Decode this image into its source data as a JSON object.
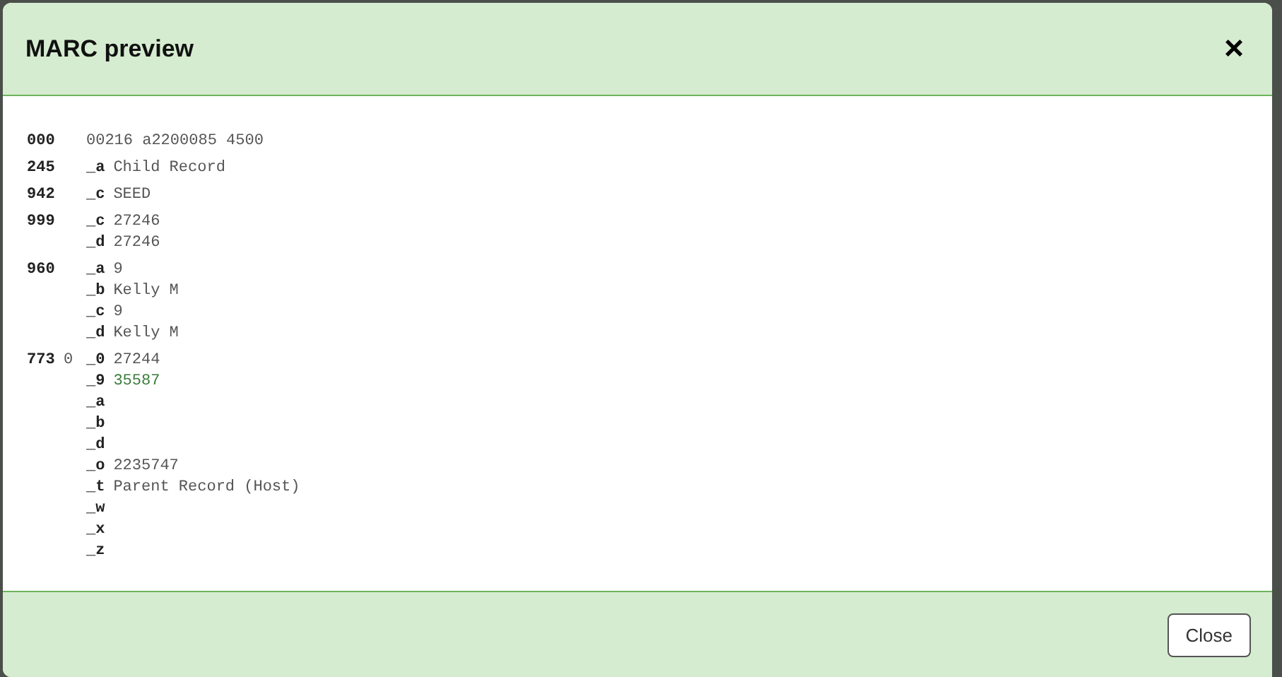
{
  "modal": {
    "title": "MARC preview",
    "close_icon": "×"
  },
  "fields": [
    {
      "tag": "000",
      "leader": "00216 a2200085 4500"
    },
    {
      "tag": "245",
      "subfields": [
        {
          "code": "_a",
          "value": "Child Record",
          "kind": "text"
        }
      ]
    },
    {
      "tag": "942",
      "subfields": [
        {
          "code": "_c",
          "value": "SEED",
          "kind": "text"
        }
      ]
    },
    {
      "tag": "999",
      "subfields": [
        {
          "code": "_c",
          "value": "27246",
          "kind": "text"
        },
        {
          "code": "_d",
          "value": "27246",
          "kind": "text"
        }
      ]
    },
    {
      "tag": "960",
      "subfields": [
        {
          "code": "_a",
          "value": "9",
          "kind": "text"
        },
        {
          "code": "_b",
          "value": "Kelly M",
          "kind": "text"
        },
        {
          "code": "_c",
          "value": "9",
          "kind": "text"
        },
        {
          "code": "_d",
          "value": "Kelly M",
          "kind": "text"
        }
      ]
    },
    {
      "tag": "773",
      "indicator": "0",
      "subfields": [
        {
          "code": "_0",
          "value": "27244",
          "kind": "text"
        },
        {
          "code": "_9",
          "value": "35587",
          "kind": "link"
        },
        {
          "code": "_a"
        },
        {
          "code": "_b"
        },
        {
          "code": "_d"
        },
        {
          "code": "_o",
          "value": "2235747",
          "kind": "text"
        },
        {
          "code": "_t",
          "value": "Parent Record (Host)",
          "kind": "text"
        },
        {
          "code": "_w"
        },
        {
          "code": "_x"
        },
        {
          "code": "_z"
        }
      ]
    }
  ],
  "footer": {
    "close_button": "Close"
  }
}
